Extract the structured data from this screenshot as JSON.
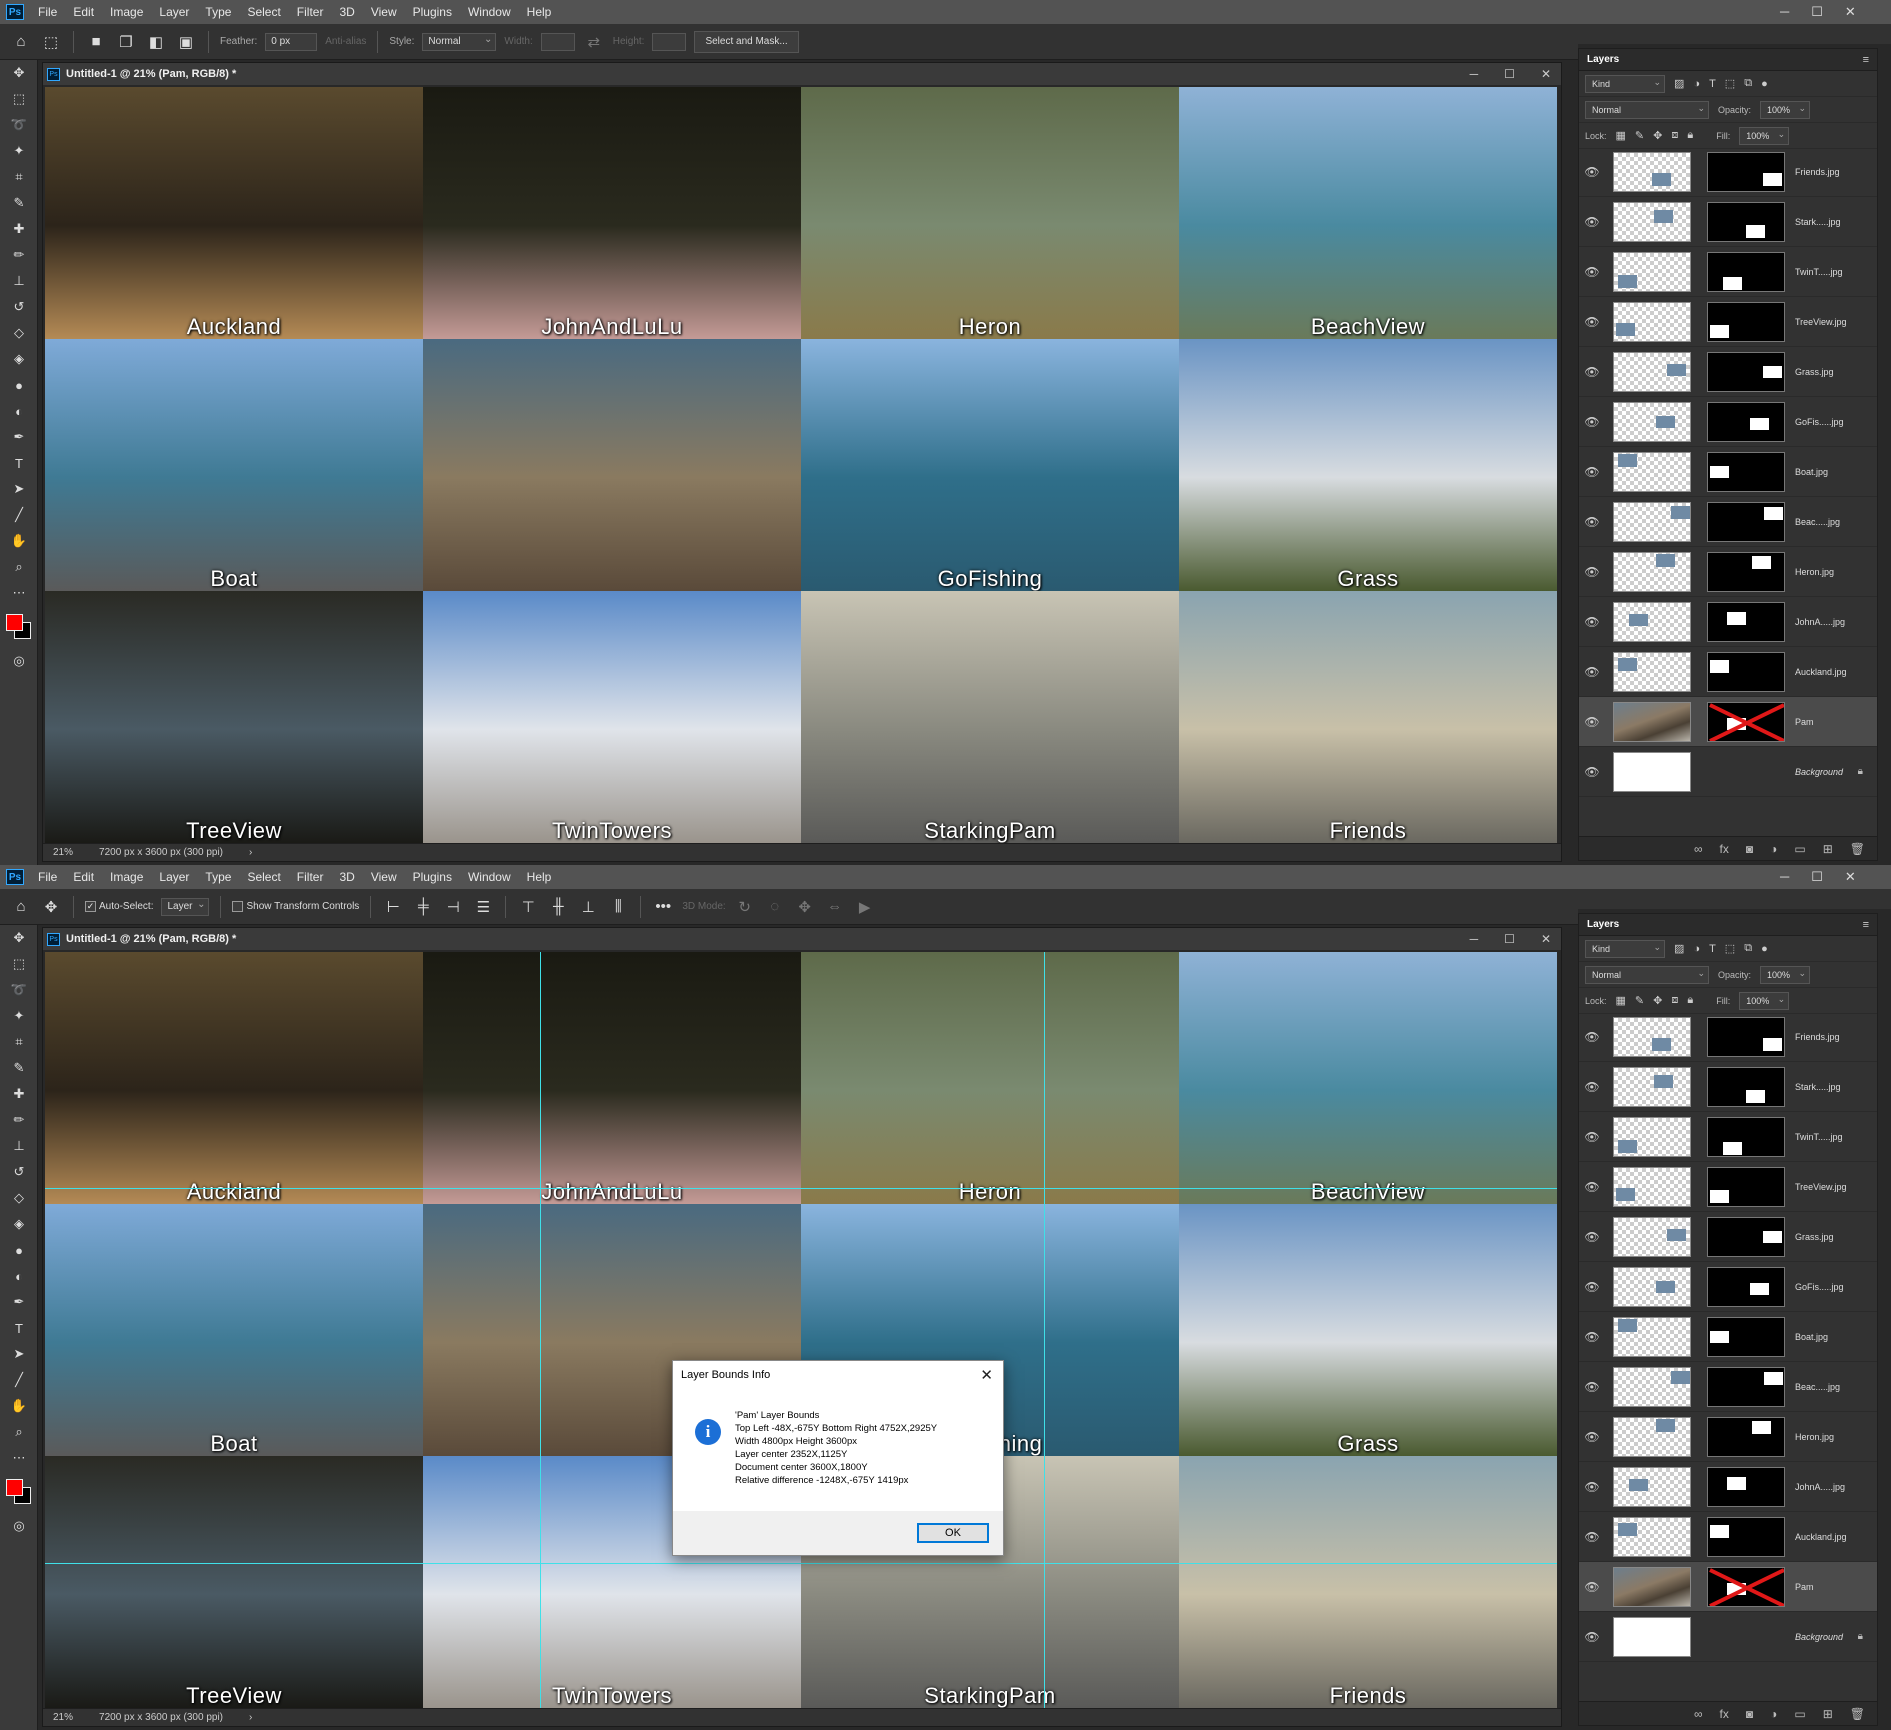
{
  "menu": [
    "File",
    "Edit",
    "Image",
    "Layer",
    "Type",
    "Select",
    "Filter",
    "3D",
    "View",
    "Plugins",
    "Window",
    "Help"
  ],
  "app_badge": "Ps",
  "marquee_options": {
    "feather_label": "Feather:",
    "feather_value": "0 px",
    "antialias_label": "Anti-alias",
    "style_label": "Style:",
    "style_value": "Normal",
    "width_label": "Width:",
    "height_label": "Height:",
    "select_mask_label": "Select and Mask..."
  },
  "move_options": {
    "auto_select_label": "Auto-Select:",
    "auto_select_value": "Layer",
    "transform_label": "Show Transform Controls",
    "mode_3d_label": "3D Mode:"
  },
  "document": {
    "tab_title": "Untitled-1 @ 21% (Pam, RGB/8) *",
    "zoom": "21%",
    "doc_info": "7200 px x 3600 px (300 ppi)"
  },
  "tiles": [
    {
      "label": "Auckland",
      "c1": "#5a4a2e",
      "c2": "#2c241a",
      "c3": "#b48a55"
    },
    {
      "label": "JohnAndLuLu",
      "c1": "#1a1a12",
      "c2": "#2a2a1e",
      "c3": "#c49a96"
    },
    {
      "label": "Heron",
      "c1": "#5e6a4a",
      "c2": "#7a8a70",
      "c3": "#8a7a4a"
    },
    {
      "label": "BeachView",
      "c1": "#8fb2d6",
      "c2": "#4a8aa0",
      "c3": "#6a7a5a"
    },
    {
      "label": "Boat",
      "c1": "#7faad8",
      "c2": "#3f7a94",
      "c3": "#5a5a5a"
    },
    {
      "label": "",
      "c1": "#4a6a80",
      "c2": "#8a7a60",
      "c3": "#5a4a3a"
    },
    {
      "label": "GoFishing",
      "c1": "#8ab4de",
      "c2": "#2f6f8a",
      "c3": "#2a5a70"
    },
    {
      "label": "Grass",
      "c1": "#6a94c4",
      "c2": "#d8dce0",
      "c3": "#4a5a30"
    },
    {
      "label": "TreeView",
      "c1": "#2a2a24",
      "c2": "#4a5a64",
      "c3": "#1a1a16"
    },
    {
      "label": "TwinTowers",
      "c1": "#5a8ac8",
      "c2": "#e0e4ea",
      "c3": "#9a948c"
    },
    {
      "label": "StarkingPam",
      "c1": "#c8c4b4",
      "c2": "#8a8a80",
      "c3": "#5a5a58"
    },
    {
      "label": "Friends",
      "c1": "#8aa4b0",
      "c2": "#c8c0a8",
      "c3": "#6a6860"
    }
  ],
  "layers_panel": {
    "tab": "Layers",
    "kind_label": "Kind",
    "blend_mode": "Normal",
    "opacity_label": "Opacity:",
    "opacity_value": "100%",
    "lock_label": "Lock:",
    "fill_label": "Fill:",
    "fill_value": "100%",
    "layers": [
      {
        "name": "Friends.jpg"
      },
      {
        "name": "Stark.....jpg"
      },
      {
        "name": "TwinT.....jpg"
      },
      {
        "name": "TreeView.jpg"
      },
      {
        "name": "Grass.jpg"
      },
      {
        "name": "GoFis.....jpg"
      },
      {
        "name": "Boat.jpg"
      },
      {
        "name": "Beac.....jpg"
      },
      {
        "name": "Heron.jpg"
      },
      {
        "name": "JohnA.....jpg"
      },
      {
        "name": "Auckland.jpg"
      },
      {
        "name": "Pam"
      },
      {
        "name": "Background"
      }
    ]
  },
  "dialog": {
    "title": "Layer Bounds Info",
    "lines": [
      "'Pam' Layer Bounds",
      "Top Left -48X,-675Y   Bottom Right 4752X,2925Y",
      "Width 4800px   Height 3600px",
      "Layer center 2352X,1125Y",
      "Document center  3600X,1800Y",
      "Relative difference  -1248X,-675Y  1419px"
    ],
    "ok_label": "OK"
  },
  "colors": {
    "foreground": "#ff0000",
    "background": "#000000",
    "guide": "#3fe0e8",
    "info_icon": "#1c6fd6"
  }
}
